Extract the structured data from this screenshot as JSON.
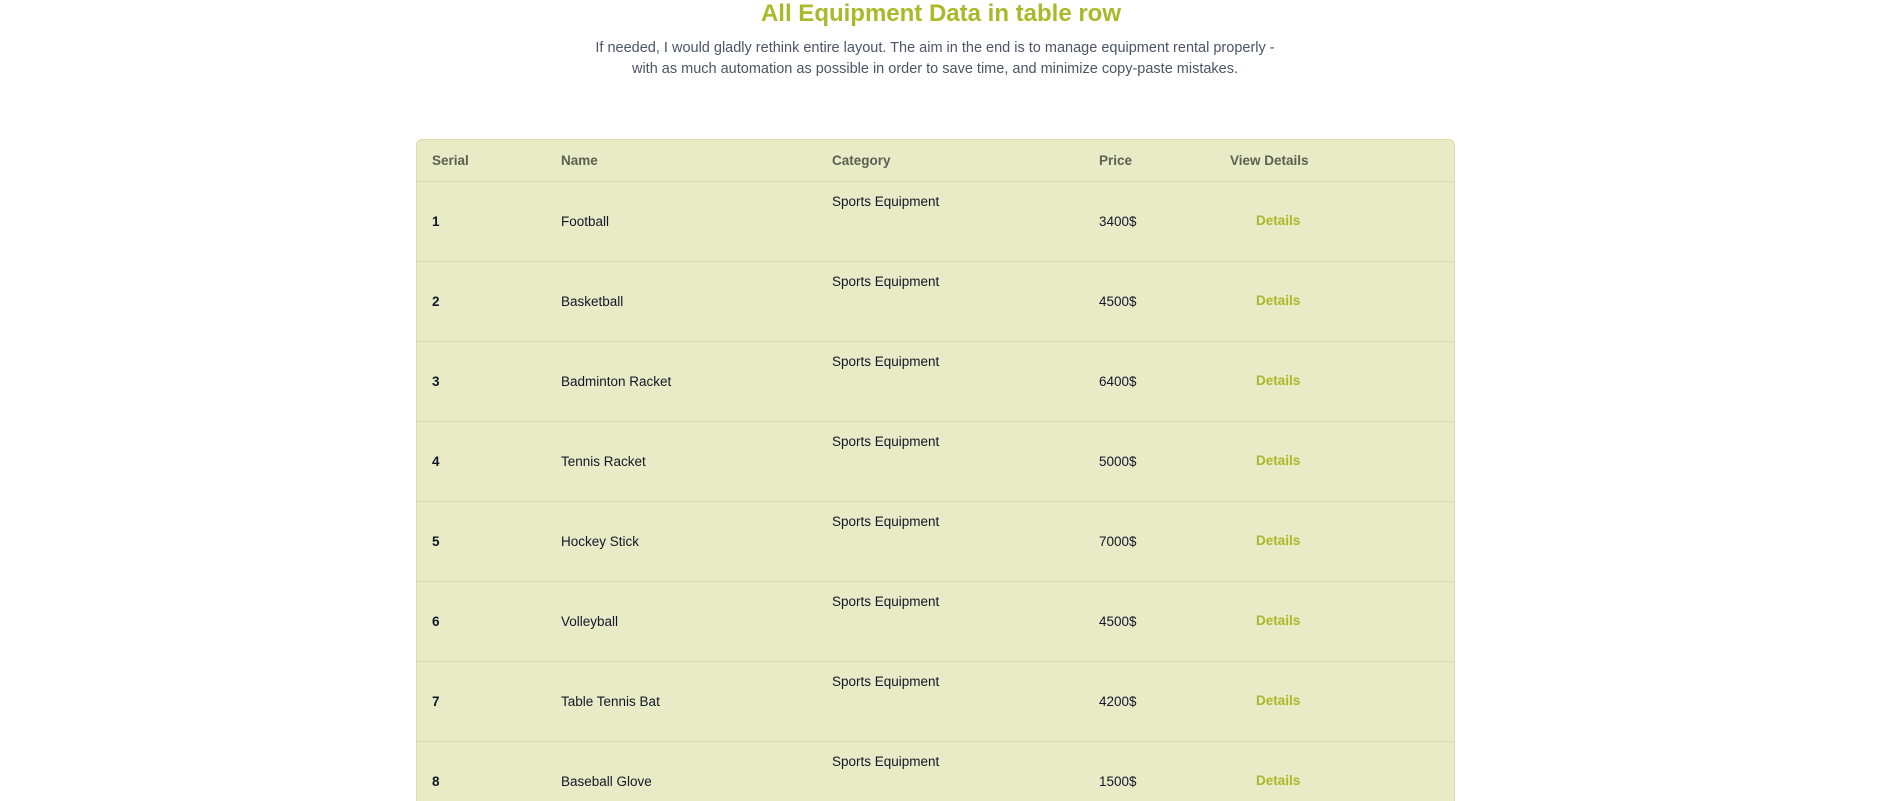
{
  "header": {
    "title": "All Equipment Data in table row",
    "subtitle_line1": "If needed, I would gladly rethink entire layout. The aim in the end is to manage equipment rental properly -",
    "subtitle_line2": "with as much automation as possible in order to save time, and minimize copy-paste mistakes."
  },
  "table": {
    "columns": [
      "Serial",
      "Name",
      "Category",
      "Price",
      "View Details"
    ],
    "rows": [
      {
        "serial": "1",
        "name": "Football",
        "category": "Sports Equipment",
        "price": "3400$",
        "action": "Details"
      },
      {
        "serial": "2",
        "name": "Basketball",
        "category": "Sports Equipment",
        "price": "4500$",
        "action": "Details"
      },
      {
        "serial": "3",
        "name": "Badminton Racket",
        "category": "Sports Equipment",
        "price": "6400$",
        "action": "Details"
      },
      {
        "serial": "4",
        "name": "Tennis Racket",
        "category": "Sports Equipment",
        "price": "5000$",
        "action": "Details"
      },
      {
        "serial": "5",
        "name": "Hockey Stick",
        "category": "Sports Equipment",
        "price": "7000$",
        "action": "Details"
      },
      {
        "serial": "6",
        "name": "Volleyball",
        "category": "Sports Equipment",
        "price": "4500$",
        "action": "Details"
      },
      {
        "serial": "7",
        "name": "Table Tennis Bat",
        "category": "Sports Equipment",
        "price": "4200$",
        "action": "Details"
      },
      {
        "serial": "8",
        "name": "Baseball Glove",
        "category": "Sports Equipment",
        "price": "1500$",
        "action": "Details"
      }
    ]
  },
  "colors": {
    "accent": "#a9b929",
    "table_background": "#e8ebc6",
    "text": "#111827",
    "muted_text": "#4b5563"
  }
}
